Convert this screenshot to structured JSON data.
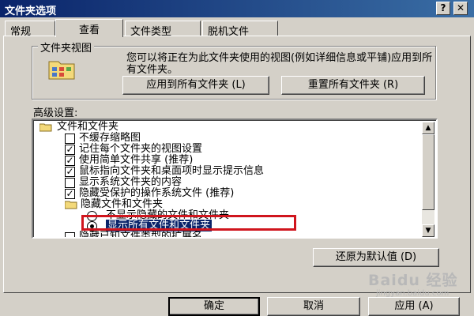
{
  "window": {
    "title": "文件夹选项",
    "help_glyph": "?",
    "close_glyph": "✕"
  },
  "tabs": [
    {
      "label": "常规"
    },
    {
      "label": "查看"
    },
    {
      "label": "文件类型"
    },
    {
      "label": "脱机文件"
    }
  ],
  "folder_views": {
    "legend": "文件夹视图",
    "description": "您可以将正在为此文件夹使用的视图(例如详细信息或平铺)应用到所有文件夹。",
    "apply_all_label": "应用到所有文件夹 (L)",
    "reset_all_label": "重置所有文件夹 (R)"
  },
  "advanced": {
    "label": "高级设置:",
    "items": [
      {
        "kind": "folder",
        "text": "文件和文件夹"
      },
      {
        "kind": "checkbox",
        "text": "不缓存缩略图",
        "checked": false
      },
      {
        "kind": "checkbox",
        "text": "记住每个文件夹的视图设置",
        "checked": true
      },
      {
        "kind": "checkbox",
        "text": "使用简单文件共享 (推荐)",
        "checked": true
      },
      {
        "kind": "checkbox",
        "text": "鼠标指向文件夹和桌面项时显示提示信息",
        "checked": true
      },
      {
        "kind": "checkbox",
        "text": "显示系统文件夹的内容",
        "checked": false
      },
      {
        "kind": "checkbox",
        "text": "隐藏受保护的操作系统文件 (推荐)",
        "checked": true
      },
      {
        "kind": "folder",
        "text": "隐藏文件和文件夹"
      },
      {
        "kind": "radio",
        "text": "不显示隐藏的文件和文件夹",
        "selected": false
      },
      {
        "kind": "radio",
        "text": "显示所有文件和文件夹",
        "selected": true
      },
      {
        "kind": "checkbox",
        "text": "隐藏已知文件类型的扩展名",
        "checked": false
      }
    ],
    "restore_defaults_label": "还原为默认值 (D)"
  },
  "footer": {
    "ok_label": "确定",
    "cancel_label": "取消",
    "apply_label": "应用 (A)"
  },
  "watermark": {
    "text": "Baidu 经验",
    "sub": "jingyan.baidu.com"
  },
  "colors": {
    "title_bar": "#0a246a",
    "selection": "#0a246a",
    "highlight_box": "#d0151d",
    "face": "#d4d0c8"
  }
}
